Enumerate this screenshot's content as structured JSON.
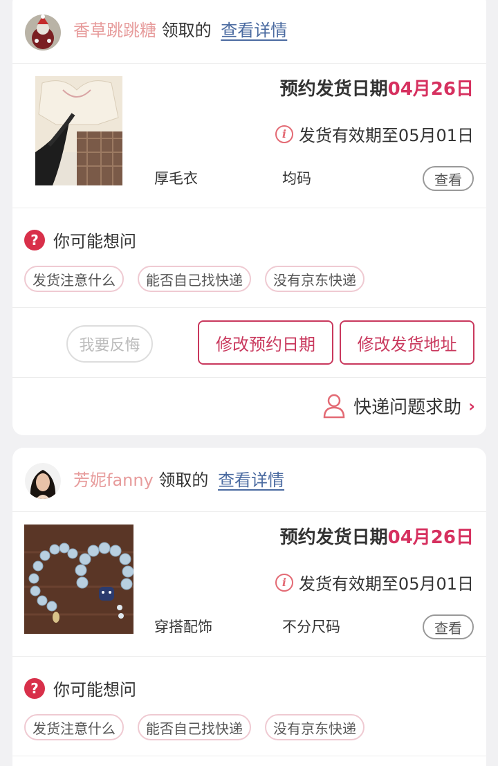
{
  "orders": [
    {
      "user_name": "香草跳跳糖",
      "received_text": "领取的",
      "detail_link": "查看详情",
      "appointment_label": "预约发货日期",
      "appointment_date": "04月26日",
      "validity_text": "发货有效期至05月01日",
      "category": "厚毛衣",
      "size": "均码",
      "view_label": "查看",
      "faq_title": "你可能想问",
      "faq_chips": [
        "发货注意什么",
        "能否自己找快递",
        "没有京东快递"
      ],
      "regret_label": "我要反悔",
      "modify_date_label": "修改预约日期",
      "modify_address_label": "修改发货地址",
      "help_label": "快递问题求助"
    },
    {
      "user_name": "芳妮fanny",
      "received_text": "领取的",
      "detail_link": "查看详情",
      "appointment_label": "预约发货日期",
      "appointment_date": "04月26日",
      "validity_text": "发货有效期至05月01日",
      "category": "穿搭配饰",
      "size": "不分尺码",
      "view_label": "查看",
      "faq_title": "你可能想问",
      "faq_chips": [
        "发货注意什么",
        "能否自己找快递",
        "没有京东快递"
      ]
    }
  ],
  "colors": {
    "accent": "#d6305f",
    "username": "#e79c9c",
    "link": "#4a6aa0"
  },
  "icons": [
    "info-icon",
    "question-icon",
    "person-icon",
    "chevron-right-icon"
  ]
}
